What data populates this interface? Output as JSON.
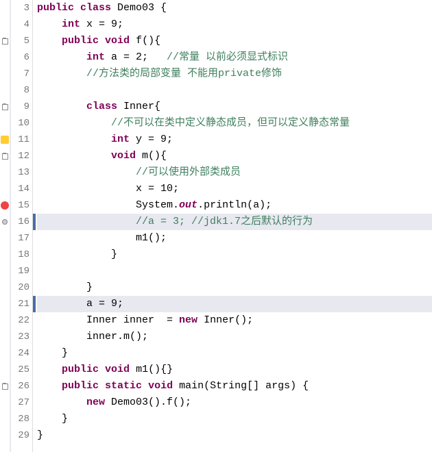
{
  "lines": [
    {
      "num": 3,
      "marker": "",
      "hl": false,
      "tokens": [
        {
          "c": "kw",
          "t": "public"
        },
        {
          "c": "txt",
          "t": " "
        },
        {
          "c": "kw",
          "t": "class"
        },
        {
          "c": "txt",
          "t": " Demo03 {"
        }
      ]
    },
    {
      "num": 4,
      "marker": "",
      "hl": false,
      "tokens": [
        {
          "c": "txt",
          "t": "    "
        },
        {
          "c": "kw",
          "t": "int"
        },
        {
          "c": "txt",
          "t": " x = 9;"
        }
      ]
    },
    {
      "num": 5,
      "marker": "fold",
      "hl": false,
      "tokens": [
        {
          "c": "txt",
          "t": "    "
        },
        {
          "c": "kw",
          "t": "public"
        },
        {
          "c": "txt",
          "t": " "
        },
        {
          "c": "kw",
          "t": "void"
        },
        {
          "c": "txt",
          "t": " f(){"
        }
      ]
    },
    {
      "num": 6,
      "marker": "",
      "hl": false,
      "tokens": [
        {
          "c": "txt",
          "t": "        "
        },
        {
          "c": "kw",
          "t": "int"
        },
        {
          "c": "txt",
          "t": " a = 2;   "
        },
        {
          "c": "com",
          "t": "//常量 以前必须显式标识"
        }
      ]
    },
    {
      "num": 7,
      "marker": "",
      "hl": false,
      "tokens": [
        {
          "c": "txt",
          "t": "        "
        },
        {
          "c": "com",
          "t": "//方法类的局部变量 不能用private修饰"
        }
      ]
    },
    {
      "num": 8,
      "marker": "",
      "hl": false,
      "tokens": []
    },
    {
      "num": 9,
      "marker": "fold",
      "hl": false,
      "tokens": [
        {
          "c": "txt",
          "t": "        "
        },
        {
          "c": "kw",
          "t": "class"
        },
        {
          "c": "txt",
          "t": " Inner{"
        }
      ]
    },
    {
      "num": 10,
      "marker": "",
      "hl": false,
      "tokens": [
        {
          "c": "txt",
          "t": "            "
        },
        {
          "c": "com",
          "t": "//不可以在类中定义静态成员，但可以定义静态常量"
        }
      ]
    },
    {
      "num": 11,
      "marker": "warn",
      "hl": false,
      "tokens": [
        {
          "c": "txt",
          "t": "            "
        },
        {
          "c": "kw",
          "t": "int"
        },
        {
          "c": "txt",
          "t": " y = 9;"
        }
      ]
    },
    {
      "num": 12,
      "marker": "fold",
      "hl": false,
      "tokens": [
        {
          "c": "txt",
          "t": "            "
        },
        {
          "c": "kw",
          "t": "void"
        },
        {
          "c": "txt",
          "t": " m(){"
        }
      ]
    },
    {
      "num": 13,
      "marker": "",
      "hl": false,
      "tokens": [
        {
          "c": "txt",
          "t": "                "
        },
        {
          "c": "com",
          "t": "//可以使用外部类成员"
        }
      ]
    },
    {
      "num": 14,
      "marker": "",
      "hl": false,
      "tokens": [
        {
          "c": "txt",
          "t": "                x = 10;"
        }
      ]
    },
    {
      "num": 15,
      "marker": "error",
      "hl": false,
      "tokens": [
        {
          "c": "txt",
          "t": "                System."
        },
        {
          "c": "kw it",
          "t": "out"
        },
        {
          "c": "txt",
          "t": ".println(a);"
        }
      ]
    },
    {
      "num": 16,
      "marker": "dot",
      "hl": true,
      "tokens": [
        {
          "c": "txt",
          "t": "                "
        },
        {
          "c": "com",
          "t": "//a = 3; //jdk1.7之后默认的行为"
        }
      ]
    },
    {
      "num": 17,
      "marker": "",
      "hl": false,
      "tokens": [
        {
          "c": "txt",
          "t": "                m1();"
        }
      ]
    },
    {
      "num": 18,
      "marker": "",
      "hl": false,
      "tokens": [
        {
          "c": "txt",
          "t": "            }"
        }
      ]
    },
    {
      "num": 19,
      "marker": "",
      "hl": false,
      "tokens": []
    },
    {
      "num": 20,
      "marker": "",
      "hl": false,
      "tokens": [
        {
          "c": "txt",
          "t": "        }"
        }
      ]
    },
    {
      "num": 21,
      "marker": "",
      "hl": true,
      "tokens": [
        {
          "c": "txt",
          "t": "        a = 9;"
        }
      ]
    },
    {
      "num": 22,
      "marker": "",
      "hl": false,
      "tokens": [
        {
          "c": "txt",
          "t": "        Inner inner  = "
        },
        {
          "c": "kw",
          "t": "new"
        },
        {
          "c": "txt",
          "t": " Inner();"
        }
      ]
    },
    {
      "num": 23,
      "marker": "",
      "hl": false,
      "tokens": [
        {
          "c": "txt",
          "t": "        inner.m();"
        }
      ]
    },
    {
      "num": 24,
      "marker": "",
      "hl": false,
      "tokens": [
        {
          "c": "txt",
          "t": "    }"
        }
      ]
    },
    {
      "num": 25,
      "marker": "",
      "hl": false,
      "tokens": [
        {
          "c": "txt",
          "t": "    "
        },
        {
          "c": "kw",
          "t": "public"
        },
        {
          "c": "txt",
          "t": " "
        },
        {
          "c": "kw",
          "t": "void"
        },
        {
          "c": "txt",
          "t": " m1(){}"
        }
      ]
    },
    {
      "num": 26,
      "marker": "fold",
      "hl": false,
      "tokens": [
        {
          "c": "txt",
          "t": "    "
        },
        {
          "c": "kw",
          "t": "public"
        },
        {
          "c": "txt",
          "t": " "
        },
        {
          "c": "kw",
          "t": "static"
        },
        {
          "c": "txt",
          "t": " "
        },
        {
          "c": "kw",
          "t": "void"
        },
        {
          "c": "txt",
          "t": " main(String[] args) {"
        }
      ]
    },
    {
      "num": 27,
      "marker": "",
      "hl": false,
      "tokens": [
        {
          "c": "txt",
          "t": "        "
        },
        {
          "c": "kw",
          "t": "new"
        },
        {
          "c": "txt",
          "t": " Demo03().f();"
        }
      ]
    },
    {
      "num": 28,
      "marker": "",
      "hl": false,
      "tokens": [
        {
          "c": "txt",
          "t": "    }"
        }
      ]
    },
    {
      "num": 29,
      "marker": "",
      "hl": false,
      "tokens": [
        {
          "c": "txt",
          "t": "}"
        }
      ]
    }
  ]
}
